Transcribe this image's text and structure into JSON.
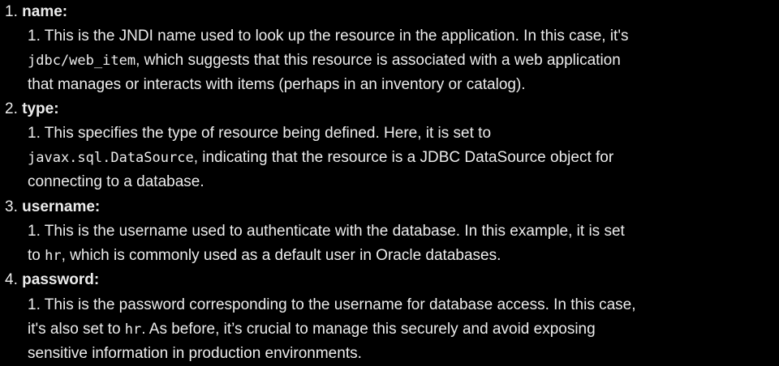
{
  "items": [
    {
      "number": "1.",
      "term": "name",
      "colon": ":",
      "sub_number": "1.",
      "line1": "This is the JNDI name used to look up the resource in the application. In this case, it's",
      "code1": "jdbc/web_item",
      "line2_rest": ", which suggests that this resource is associated with a web application",
      "line3": "that manages or interacts with items (perhaps in an inventory or catalog)."
    },
    {
      "number": "2.",
      "term": "type",
      "colon": ":",
      "sub_number": "1.",
      "line1": "This specifies the type of resource being defined. Here, it is set to",
      "code1": "javax.sql.DataSource",
      "line2_rest": ", indicating that the resource is a JDBC DataSource object for",
      "line3": "connecting to a database."
    },
    {
      "number": "3.",
      "term": "username",
      "colon": ":",
      "sub_number": "1.",
      "line1": "This is the username used to authenticate with the database. In this example, it is set",
      "line2_pre": "to ",
      "code1": "hr",
      "line2_rest": ", which is commonly used as a default user in Oracle databases."
    },
    {
      "number": "4.",
      "term": "password",
      "colon": ":",
      "sub_number": "1.",
      "line1": "This is the password corresponding to the username for database access. In this case,",
      "line2_pre": "it's also set to ",
      "code1": "hr",
      "line2_rest": ". As before, it’s crucial to manage this securely and avoid exposing",
      "line3": "sensitive information in production environments."
    }
  ]
}
